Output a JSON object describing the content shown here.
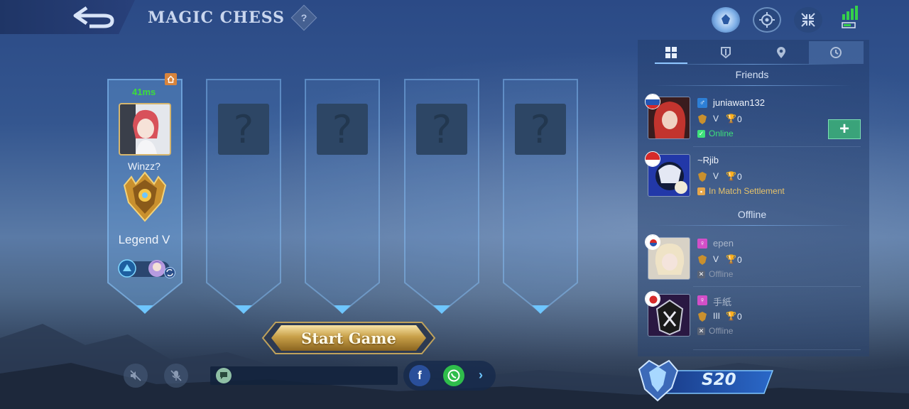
{
  "header": {
    "title": "MAGIC CHESS",
    "help_label": "?"
  },
  "lobby": {
    "host": {
      "ping": "41ms",
      "name": "Winzz?",
      "rank": "Legend V"
    },
    "empty_slot_label": "?",
    "start_label": "Start Game"
  },
  "panel": {
    "friends_title": "Friends",
    "offline_title": "Offline",
    "add_label": "+",
    "friends": [
      {
        "name": "juniawan132",
        "gender": "male",
        "rank": "V",
        "trophies": "0",
        "status": "Online",
        "status_color": "#3ee07a",
        "flag": "russia"
      },
      {
        "name": "~Rjib",
        "gender": "none",
        "rank": "V",
        "trophies": "0",
        "status": "In Match Settlement",
        "status_color": "#e6c26a",
        "flag": "indonesia"
      }
    ],
    "offline": [
      {
        "name": "epen",
        "gender": "female",
        "rank": "V",
        "trophies": "0",
        "status": "Offline",
        "flag": "korea"
      },
      {
        "name": "手紙",
        "gender": "female",
        "rank": "III",
        "trophies": "0",
        "status": "Offline",
        "flag": "japan"
      }
    ]
  },
  "season": {
    "label": "S20"
  },
  "colors": {
    "accent": "#8fc6ff",
    "online": "#3ee07a",
    "ping": "#3ddd3a",
    "gold": "#d6b66e"
  },
  "icons": [
    "back-arrow-icon",
    "help-icon",
    "shop-icon",
    "target-icon",
    "collapse-icon",
    "signal-icon",
    "grid-icon",
    "guild-icon",
    "location-icon",
    "history-icon",
    "mute-icon",
    "mic-off-icon",
    "chat-icon",
    "facebook-icon",
    "whatsapp-icon",
    "chevron-right-icon",
    "add-icon"
  ]
}
